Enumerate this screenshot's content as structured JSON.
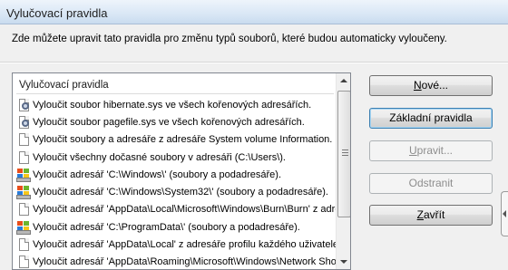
{
  "window": {
    "title": "Vylučovací pravidla"
  },
  "intro_text": "Zde můžete upravit tato pravidla pro změnu typů souborů, které budou automaticky vyloučeny.",
  "list": {
    "header": "Vylučovací pravidla",
    "rows": [
      {
        "icon": "gear-file-icon",
        "text": "Vyloučit soubor hibernate.sys ve všech kořenových adresářích."
      },
      {
        "icon": "gear-file-icon",
        "text": "Vyloučit soubor pagefile.sys ve všech kořenových adresářích."
      },
      {
        "icon": "file-icon",
        "text": "Vyloučit soubory a adresáře z adresáře System volume Information."
      },
      {
        "icon": "file-icon",
        "text": "Vyloučit všechny dočasné soubory v adresáři (C:\\Users\\)."
      },
      {
        "icon": "windows-drive-icon",
        "text": "Vyloučit adresář 'C:\\Windows\\' (soubory a podadresáře)."
      },
      {
        "icon": "windows-drive-icon",
        "text": "Vyloučit adresář 'C:\\Windows\\System32\\' (soubory a podadresáře)."
      },
      {
        "icon": "file-icon",
        "text": "Vyloučit adresář 'AppData\\Local\\Microsoft\\Windows\\Burn\\Burn' z adresáře"
      },
      {
        "icon": "windows-drive-icon",
        "text": "Vyloučit adresář 'C:\\ProgramData\\' (soubory a podadresáře)."
      },
      {
        "icon": "file-icon",
        "text": "Vyloučit adresář 'AppData\\Local' z adresáře profilu každého uživatele."
      },
      {
        "icon": "file-icon",
        "text": "Vyloučit adresář 'AppData\\Roaming\\Microsoft\\Windows\\Network Sho"
      }
    ]
  },
  "buttons": {
    "new": {
      "label": "Nové...",
      "accel": "N",
      "rest": "ové..."
    },
    "default_rules": {
      "label": "Základní pravidla"
    },
    "edit": {
      "label": "Upravit...",
      "accel": "U",
      "rest": "pravit..."
    },
    "remove": {
      "label": "Odstranit"
    },
    "close": {
      "label": "Zavřít",
      "accel": "Z",
      "rest": "avřít"
    }
  }
}
